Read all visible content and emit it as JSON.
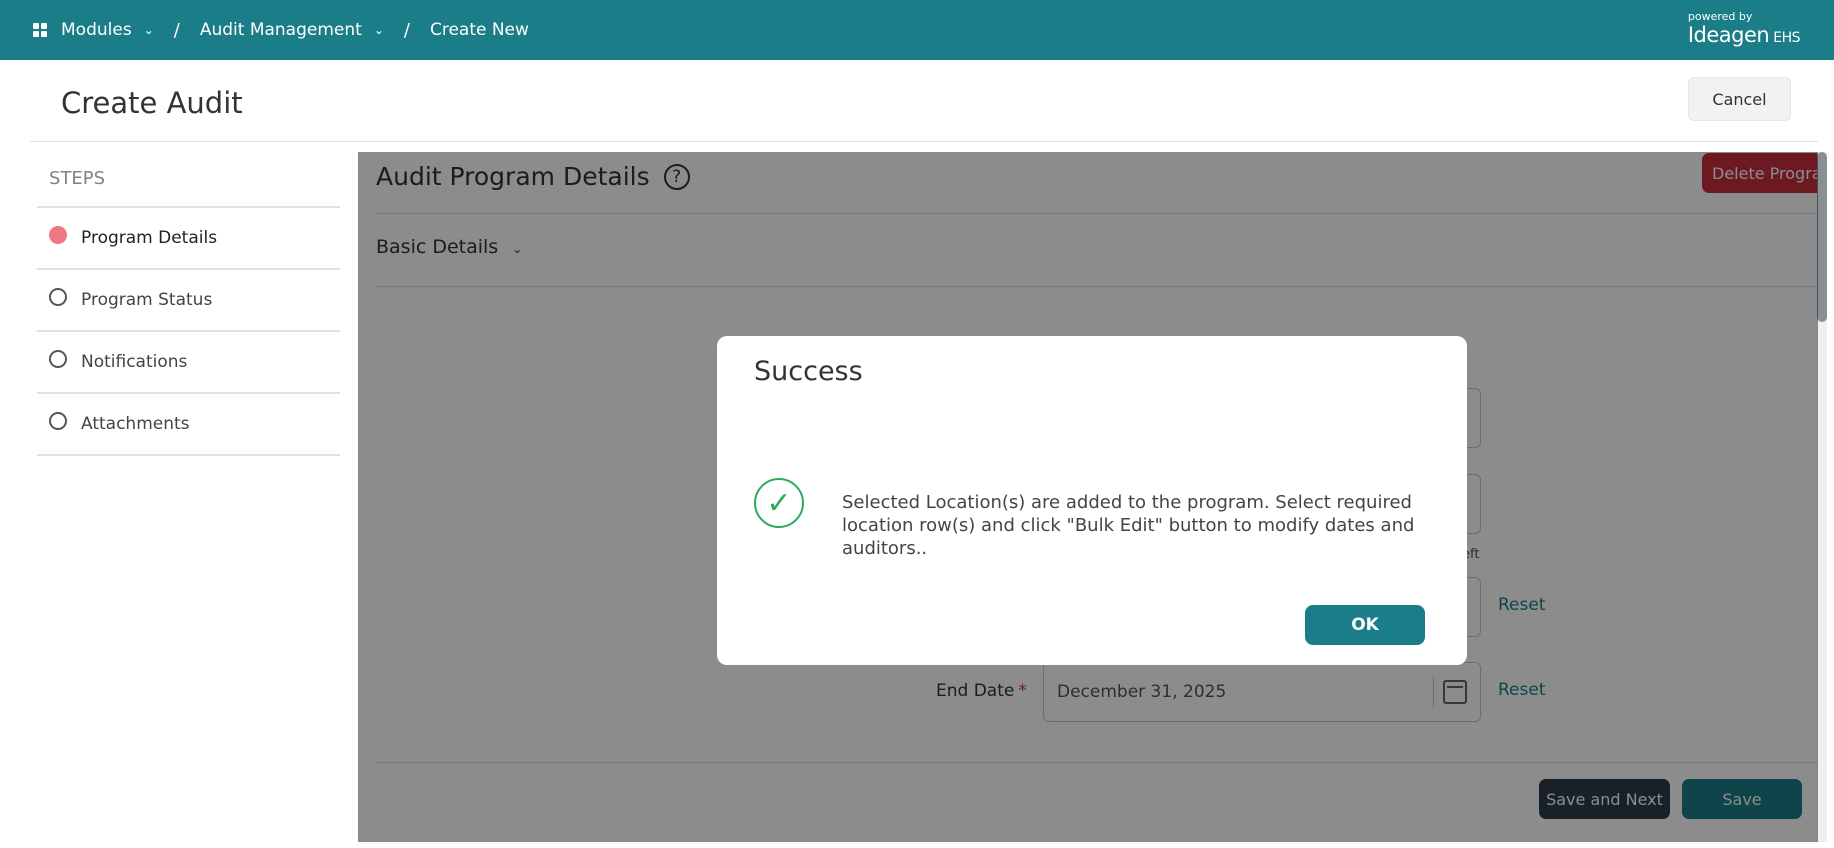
{
  "topbar": {
    "modules": "Modules",
    "audit_management": "Audit Management",
    "create_new": "Create New",
    "sep": "/",
    "brand_powered": "powered by",
    "brand_name": "Ideagen",
    "brand_suffix": "EHS",
    "color": "#1b7d88"
  },
  "page": {
    "title": "Create Audit",
    "cancel_label": "Cancel"
  },
  "steps": {
    "title": "STEPS",
    "items": [
      {
        "label": "Program Details",
        "active": true
      },
      {
        "label": "Program Status",
        "active": false
      },
      {
        "label": "Notifications",
        "active": false
      },
      {
        "label": "Attachments",
        "active": false
      }
    ]
  },
  "main": {
    "title": "Audit Program Details",
    "help": "?",
    "delete_label": "Delete Program",
    "section_title": "Basic Details",
    "end_date_label": "End Date",
    "required_mark": "*",
    "end_date_value": "December 31, 2025",
    "reset_label": "Reset",
    "hint_fragment": "eft",
    "save_next_label": "Save and Next",
    "save_label": "Save"
  },
  "modal": {
    "title": "Success",
    "message": "Selected Location(s) are added to the program. Select required location row(s) and click \"Bulk Edit\" button to modify dates and auditors..",
    "ok_label": "OK"
  }
}
